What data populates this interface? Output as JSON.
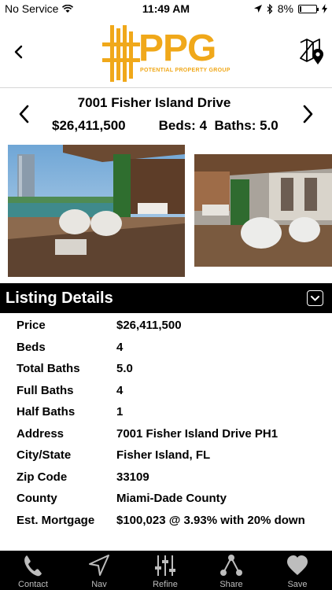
{
  "status_bar": {
    "carrier": "No Service",
    "time": "11:49 AM",
    "battery_text": "8%",
    "battery_level": 0.08
  },
  "header": {
    "logo_text": "PPG",
    "logo_subtitle": "POTENTIAL PROPERTY GROUP",
    "icons": {
      "back": "chevron-left-icon",
      "map": "map-pin-icon"
    }
  },
  "listing": {
    "address_title": "7001 Fisher Island Drive",
    "price": "$26,411,500",
    "beds_label": "Beds: 4",
    "baths_label": "Baths: 5.0"
  },
  "details": {
    "section_title": "Listing Details",
    "rows": [
      {
        "key": "Price",
        "value": "$26,411,500"
      },
      {
        "key": "Beds",
        "value": "4"
      },
      {
        "key": "Total Baths",
        "value": "5.0"
      },
      {
        "key": "Full Baths",
        "value": "4"
      },
      {
        "key": "Half Baths",
        "value": "1"
      },
      {
        "key": "Address",
        "value": "7001 Fisher Island Drive PH1"
      },
      {
        "key": "City/State",
        "value": "Fisher Island, FL"
      },
      {
        "key": "Zip Code",
        "value": "33109"
      },
      {
        "key": "County",
        "value": "Miami-Dade County"
      },
      {
        "key": "Est. Mortgage",
        "value": "$100,023 @ 3.93% with 20% down"
      }
    ]
  },
  "tabbar": {
    "tabs": [
      {
        "label": "Contact",
        "icon": "phone-icon"
      },
      {
        "label": "Nav",
        "icon": "navigation-arrow-icon"
      },
      {
        "label": "Refine",
        "icon": "sliders-icon"
      },
      {
        "label": "Share",
        "icon": "share-icon"
      },
      {
        "label": "Save",
        "icon": "heart-icon"
      }
    ]
  },
  "colors": {
    "brand": "#f0a81a",
    "bar_background": "#000000",
    "tab_text": "#bdbdbd"
  }
}
